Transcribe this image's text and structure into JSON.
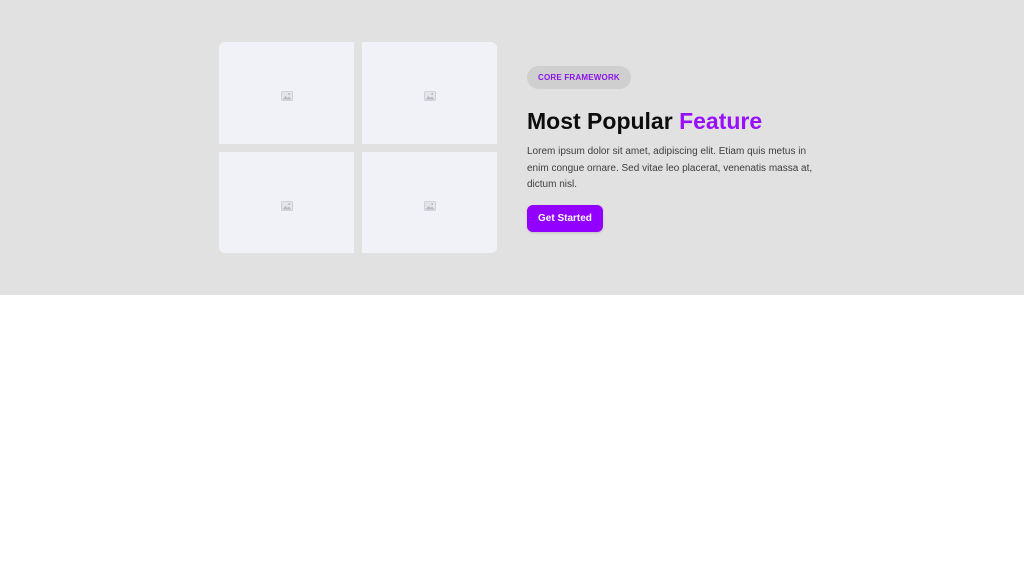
{
  "colors": {
    "hero_background": "#e1e1e1",
    "tile_background": "#f1f2f7",
    "accent": "#9810fa",
    "button": "#9200ff",
    "badge_background": "#cfcfcf"
  },
  "gallery": {
    "tiles": [
      {
        "icon": "image-placeholder-icon"
      },
      {
        "icon": "image-placeholder-icon"
      },
      {
        "icon": "image-placeholder-icon"
      },
      {
        "icon": "image-placeholder-icon"
      }
    ]
  },
  "feature": {
    "badge": "CORE FRAMEWORK",
    "title_main": "Most Popular ",
    "title_accent": "Feature",
    "description": "Lorem ipsum dolor sit amet, adipiscing elit. Etiam quis metus in enim congue ornare. Sed vitae leo placerat, venenatis massa at, dictum nisl.",
    "cta_label": "Get Started"
  }
}
